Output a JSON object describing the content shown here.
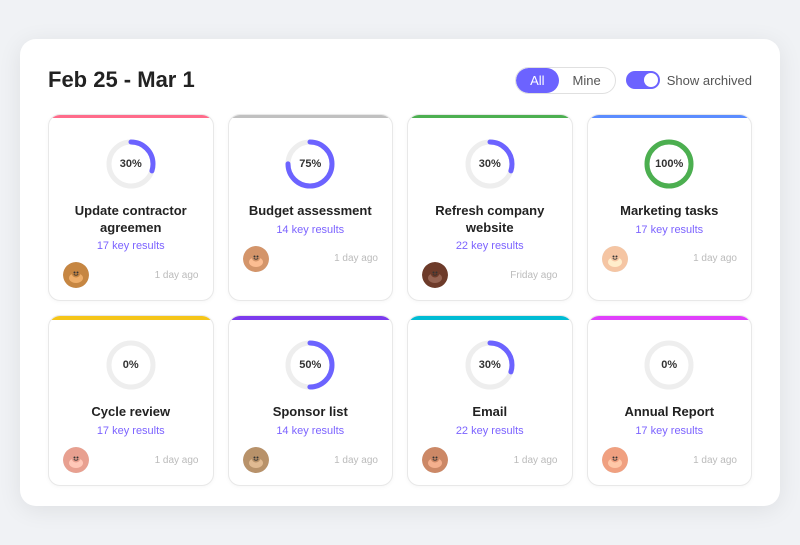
{
  "header": {
    "title": "Feb 25 - Mar 1",
    "filter_all": "All",
    "filter_mine": "Mine",
    "toggle_label": "Show archived"
  },
  "cards": [
    {
      "id": "card-1",
      "color": "pink",
      "percent": 30,
      "arc_color": "#6c63ff",
      "title": "Update contractor agreemen",
      "key_results": "17 key results",
      "time": "1 day ago",
      "avatar_color": "brown"
    },
    {
      "id": "card-2",
      "color": "gray",
      "percent": 75,
      "arc_color": "#6c63ff",
      "title": "Budget assessment",
      "key_results": "14 key results",
      "time": "1 day ago",
      "avatar_color": "medium"
    },
    {
      "id": "card-3",
      "color": "green",
      "percent": 30,
      "arc_color": "#6c63ff",
      "title": "Refresh company website",
      "key_results": "22 key results",
      "time": "Friday ago",
      "avatar_color": "dark"
    },
    {
      "id": "card-4",
      "color": "blue",
      "percent": 100,
      "arc_color": "#4caf50",
      "title": "Marketing tasks",
      "key_results": "17 key results",
      "time": "1 day ago",
      "avatar_color": "light"
    },
    {
      "id": "card-5",
      "color": "yellow",
      "percent": 0,
      "arc_color": "#6c63ff",
      "title": "Cycle review",
      "key_results": "17 key results",
      "time": "1 day ago",
      "avatar_color": "rose"
    },
    {
      "id": "card-6",
      "color": "purple",
      "percent": 50,
      "arc_color": "#6c63ff",
      "title": "Sponsor list",
      "key_results": "14 key results",
      "time": "1 day ago",
      "avatar_color": "olive"
    },
    {
      "id": "card-7",
      "color": "cyan",
      "percent": 30,
      "arc_color": "#6c63ff",
      "title": "Email",
      "key_results": "22 key results",
      "time": "1 day ago",
      "avatar_color": "tan"
    },
    {
      "id": "card-8",
      "color": "magenta",
      "percent": 0,
      "arc_color": "#6c63ff",
      "title": "Annual Report",
      "key_results": "17 key results",
      "time": "1 day ago",
      "avatar_color": "pink-skin"
    }
  ]
}
